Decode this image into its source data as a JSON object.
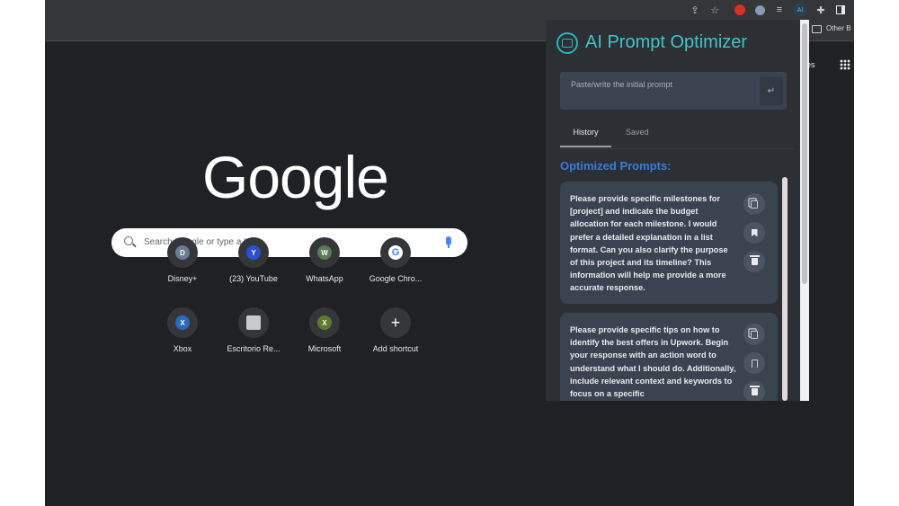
{
  "toolbar": {
    "icons": [
      "share-icon",
      "star-icon",
      "ext-red-icon",
      "ext-shield-icon",
      "ext-list-icon",
      "ext-prompt-icon",
      "puzzle-icon",
      "sidepanel-icon"
    ]
  },
  "bookmarks": {
    "other_label": "Other B"
  },
  "ntp": {
    "logo": "Google",
    "search_placeholder": "Search Google or type a URL",
    "shortcuts": [
      {
        "letter": "D",
        "label": "Disney+",
        "color": "#6b7b93"
      },
      {
        "letter": "Y",
        "label": "(23) YouTube",
        "color": "#2b4fd3"
      },
      {
        "letter": "W",
        "label": "WhatsApp",
        "color": "#5a7a5a"
      },
      {
        "letter": "G",
        "label": "Google Chro...",
        "color": "#ffffff"
      },
      {
        "letter": "X",
        "label": "Xbox",
        "color": "#2a6bbd"
      },
      {
        "letter": "",
        "label": "Escritorio Re...",
        "color": "#c9c9c9"
      },
      {
        "letter": "X",
        "label": "Microsoft",
        "color": "#5d7a2e"
      },
      {
        "letter": "+",
        "label": "Add shortcut",
        "color": "#35363a"
      }
    ],
    "right_label": "ges"
  },
  "panel": {
    "title": "AI Prompt Optimizer",
    "input_placeholder": "Paste/write the initial prompt",
    "enter_symbol": "↵",
    "tabs": [
      {
        "label": "History",
        "active": true
      },
      {
        "label": "Saved",
        "active": false
      }
    ],
    "section_title": "Optimized Prompts:",
    "prompts": [
      {
        "text": "Please provide specific milestones for [project] and indicate the budget allocation for each milestone. I would prefer a detailed explanation in a list format. Can you also clarify the purpose of this project and its timeline? This information will help me provide a more accurate response."
      },
      {
        "text": "Please provide specific tips on how to identify the best offers in Upwork. Begin your response with an action word to understand what I should do. Additionally, include relevant context and keywords to focus on a specific"
      }
    ]
  }
}
